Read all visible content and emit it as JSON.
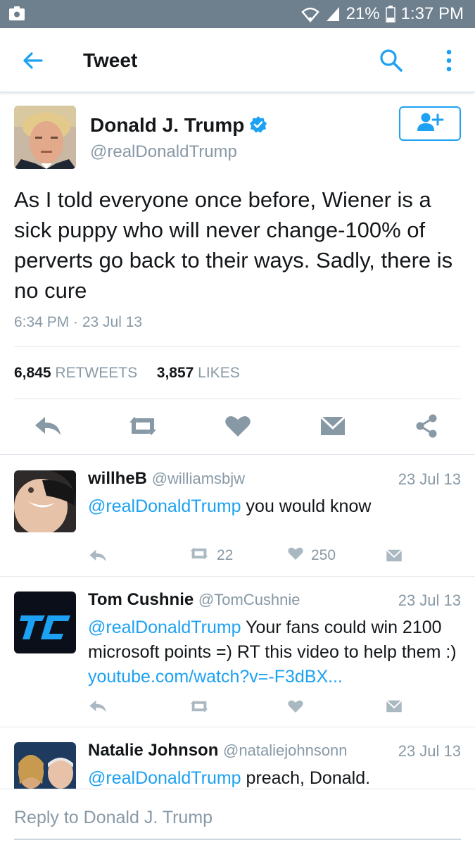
{
  "status_bar": {
    "battery": "21%",
    "time": "1:37 PM",
    "icons": [
      "photo-icon",
      "wifi-icon",
      "signal-icon",
      "battery-icon"
    ]
  },
  "app_bar": {
    "title": "Tweet",
    "icons": [
      "back-arrow-icon",
      "search-icon",
      "more-vertical-icon"
    ]
  },
  "tweet": {
    "author_name": "Donald J. Trump",
    "author_handle": "@realDonaldTrump",
    "text": "As I told everyone once before, Wiener is a sick puppy who will never change-100% of perverts go back to their ways. Sadly, there is no cure",
    "timestamp": "6:34 PM · 23 Jul 13",
    "retweets_count": "6,845",
    "retweets_label": "RETWEETS",
    "likes_count": "3,857",
    "likes_label": "LIKES",
    "actions": [
      "reply-icon",
      "retweet-icon",
      "like-icon",
      "direct-message-icon",
      "share-icon"
    ]
  },
  "replies": [
    {
      "name": "willheB",
      "handle": "@williamsbjw",
      "date": "23 Jul 13",
      "mention": "@realDonaldTrump",
      "text": " you would know",
      "link": "",
      "retweets": "22",
      "likes": "250"
    },
    {
      "name": "Tom Cushnie",
      "handle": "@TomCushnie",
      "date": "23 Jul 13",
      "mention": "@realDonaldTrump",
      "text": " Your fans could win 2100 microsoft points =) RT this video to help them :) ",
      "link": "youtube.com/watch?v=-F3dBX...",
      "retweets": "",
      "likes": ""
    },
    {
      "name": "Natalie Johnson",
      "handle": "@nataliejohnsonn",
      "date": "23 Jul 13",
      "mention": "@realDonaldTrump",
      "text": " preach, Donald.",
      "link": ""
    }
  ],
  "composer": {
    "placeholder": "Reply to Donald J. Trump"
  },
  "colors": {
    "accent": "#1da1f2",
    "status_bar": "#6e7f8d",
    "muted_text": "#8899a6",
    "icon_gray": "#aab8c2",
    "divider": "#e1e8ed"
  }
}
